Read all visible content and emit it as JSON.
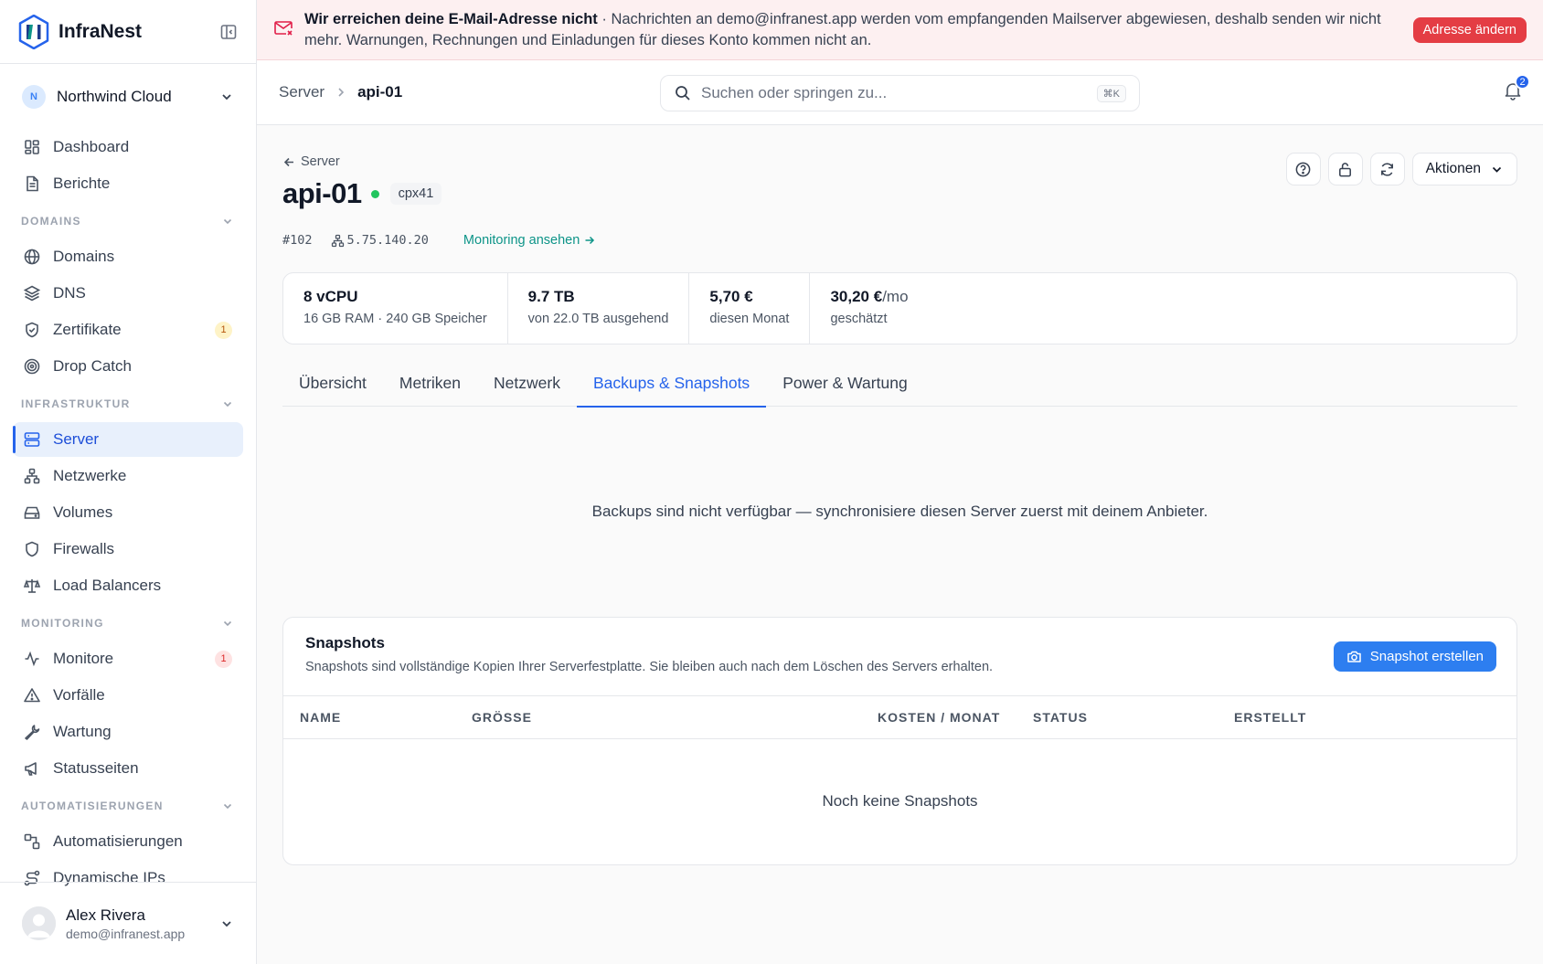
{
  "brand": {
    "name": "InfraNest"
  },
  "org": {
    "initial": "N",
    "name": "Northwind Cloud"
  },
  "nav": {
    "top": [
      {
        "label": "Dashboard"
      },
      {
        "label": "Berichte"
      }
    ],
    "sections": [
      {
        "title": "DOMAINS",
        "items": [
          {
            "label": "Domains"
          },
          {
            "label": "DNS"
          },
          {
            "label": "Zertifikate",
            "badge": "1"
          },
          {
            "label": "Drop Catch"
          }
        ]
      },
      {
        "title": "INFRASTRUKTUR",
        "items": [
          {
            "label": "Server"
          },
          {
            "label": "Netzwerke"
          },
          {
            "label": "Volumes"
          },
          {
            "label": "Firewalls"
          },
          {
            "label": "Load Balancers"
          }
        ]
      },
      {
        "title": "MONITORING",
        "items": [
          {
            "label": "Monitore",
            "badge": "1"
          },
          {
            "label": "Vorfälle"
          },
          {
            "label": "Wartung"
          },
          {
            "label": "Statusseiten"
          }
        ]
      },
      {
        "title": "AUTOMATISIERUNGEN",
        "items": [
          {
            "label": "Automatisierungen"
          },
          {
            "label": "Dynamische IPs"
          }
        ]
      }
    ]
  },
  "user": {
    "name": "Alex Rivera",
    "email": "demo@infranest.app"
  },
  "alert": {
    "title": "Wir erreichen deine E-Mail-Adresse nicht",
    "separator": " · ",
    "text": "Nachrichten an demo@infranest.app werden vom empfangenden Mailserver abgewiesen, deshalb senden wir nicht mehr. Warnungen, Rechnungen und Einladungen für dieses Konto kommen nicht an.",
    "button": "Adresse ändern"
  },
  "topbar": {
    "breadcrumb": [
      "Server",
      "api-01"
    ],
    "search_placeholder": "Suchen oder springen zu...",
    "search_shortcut": "⌘K",
    "notifications": "2"
  },
  "server": {
    "back_label": "Server",
    "name": "api-01",
    "type": "cpx41",
    "id": "#102",
    "ip": "5.75.140.20",
    "monitoring_link": "Monitoring ansehen",
    "actions_label": "Aktionen"
  },
  "stats": [
    {
      "value": "8 vCPU",
      "label": "16 GB RAM · 240 GB Speicher"
    },
    {
      "value": "9.7 TB",
      "label": "von 22.0 TB ausgehend"
    },
    {
      "value": "5,70 €",
      "label": "diesen Monat"
    },
    {
      "value": "30,20 €",
      "suffix": "/mo",
      "label": "geschätzt"
    }
  ],
  "tabs": [
    "Übersicht",
    "Metriken",
    "Netzwerk",
    "Backups & Snapshots",
    "Power & Wartung"
  ],
  "backups_message": "Backups sind nicht verfügbar — synchronisiere diesen Server zuerst mit deinem Anbieter.",
  "snapshots": {
    "title": "Snapshots",
    "description": "Snapshots sind vollständige Kopien Ihrer Serverfestplatte. Sie bleiben auch nach dem Löschen des Servers erhalten.",
    "create_button": "Snapshot erstellen",
    "columns": [
      "NAME",
      "GRÖSSE",
      "KOSTEN / MONAT",
      "STATUS",
      "ERSTELLT"
    ],
    "empty": "Noch keine Snapshots"
  },
  "colors": {
    "accent": "#2563eb",
    "danger": "#e43d44",
    "success": "#22c55e",
    "link": "#0d9488"
  }
}
